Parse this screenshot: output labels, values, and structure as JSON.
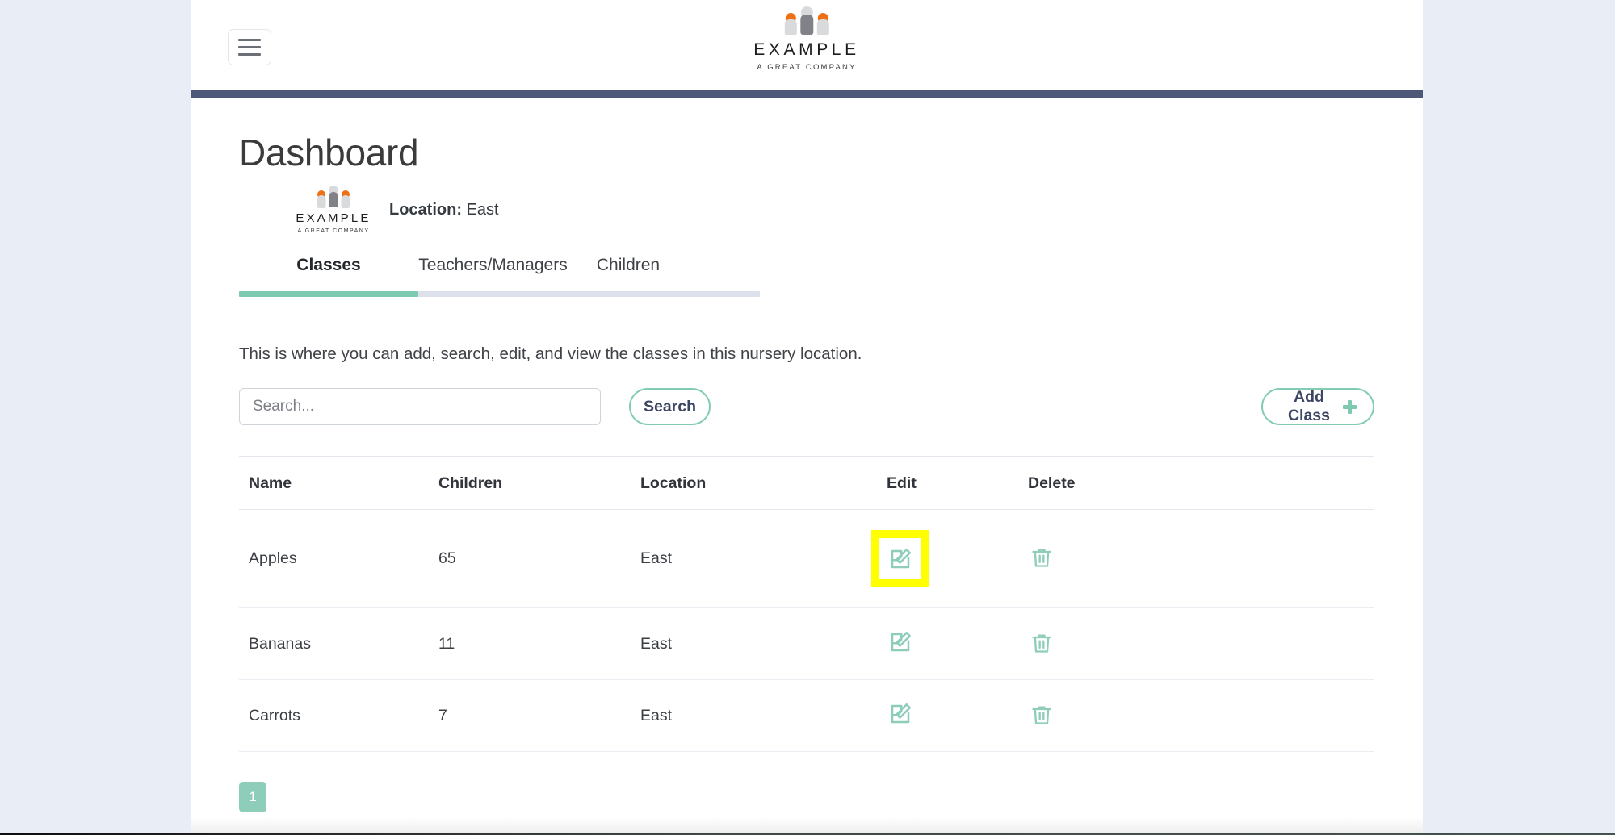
{
  "brand": {
    "name": "EXAMPLE",
    "tagline": "A GREAT COMPANY",
    "logo_icon": "people-group-icon",
    "colors": {
      "accent_orange": "#ed7014",
      "figure_gray": "#808288",
      "figure_light": "#d9dadc"
    }
  },
  "navbar": {
    "menu_icon": "hamburger-menu-icon",
    "divider_color": "#4d5878"
  },
  "header": {
    "title": "Dashboard",
    "location_label": "Location:",
    "location_value": "East"
  },
  "tabs": [
    {
      "label": "Classes",
      "active": true
    },
    {
      "label": "Teachers/Managers",
      "active": false
    },
    {
      "label": "Children",
      "active": false
    }
  ],
  "main": {
    "description": "This is where you can add, search, edit, and view the classes in this nursery location."
  },
  "search": {
    "placeholder": "Search...",
    "value": "",
    "button_label": "Search"
  },
  "toolbar": {
    "add_label": "Add Class",
    "add_icon": "plus-icon"
  },
  "table": {
    "columns": [
      "Name",
      "Children",
      "Location",
      "Edit",
      "Delete"
    ],
    "rows": [
      {
        "name": "Apples",
        "children": "65",
        "location": "East",
        "edit_icon": "edit-pencil-icon",
        "delete_icon": "trash-icon",
        "highlighted": true
      },
      {
        "name": "Bananas",
        "children": "11",
        "location": "East",
        "edit_icon": "edit-pencil-icon",
        "delete_icon": "trash-icon",
        "highlighted": false
      },
      {
        "name": "Carrots",
        "children": "7",
        "location": "East",
        "edit_icon": "edit-pencil-icon",
        "delete_icon": "trash-icon",
        "highlighted": false
      }
    ]
  },
  "pagination": {
    "pages": [
      "1"
    ],
    "current": "1"
  },
  "theme": {
    "accent_green": "#7fcbb2",
    "icon_green": "#8ecdb9",
    "navy": "#3c4563",
    "page_background": "#e9edf5",
    "highlight": "#ffff00"
  }
}
